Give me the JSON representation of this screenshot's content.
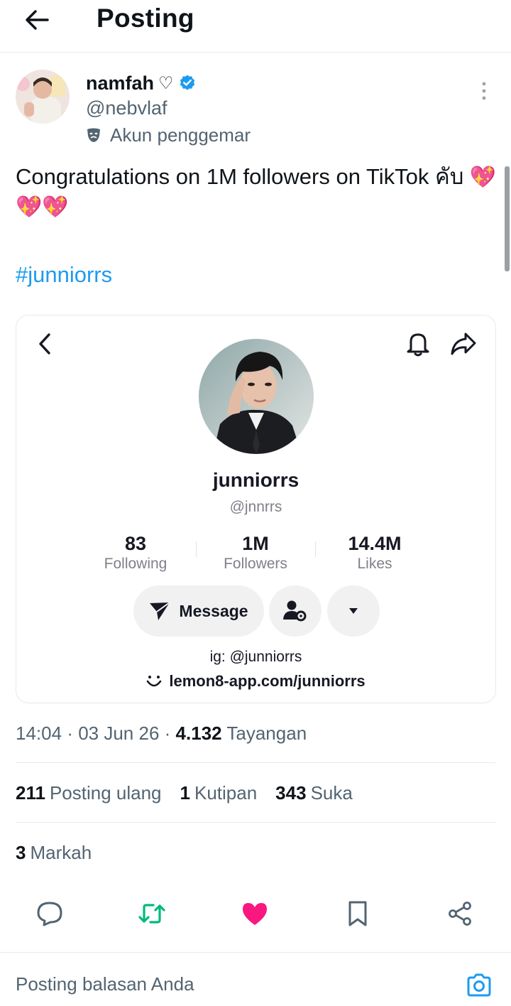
{
  "header": {
    "title": "Posting",
    "back_icon": "arrow-left-icon"
  },
  "author": {
    "name": "namfah",
    "name_suffix": "♡",
    "verified_color": "#1d9bf0",
    "handle": "@nebvlaf",
    "label": "Akun penggemar"
  },
  "tweet": {
    "text": "Congratulations on 1M followers on TikTok คับ",
    "emojis": "💖💖💖",
    "hashtag": "#junniorrs"
  },
  "card": {
    "profile_name": "junniorrs",
    "profile_handle": "@jnnrrs",
    "stats": [
      {
        "value": "83",
        "label": "Following"
      },
      {
        "value": "1M",
        "label": "Followers"
      },
      {
        "value": "14.4M",
        "label": "Likes"
      }
    ],
    "message_label": "Message",
    "bio_ig": "ig: @junniorrs",
    "bio_link": "lemon8-app.com/junniorrs"
  },
  "meta": {
    "time": "14:04",
    "date": "03 Jun 26",
    "views": "4.132",
    "views_label": "Tayangan"
  },
  "counts": {
    "reposts": "211",
    "reposts_label": "Posting ulang",
    "quotes": "1",
    "quotes_label": "Kutipan",
    "likes": "343",
    "likes_label": "Suka",
    "bookmarks": "3",
    "bookmarks_label": "Markah"
  },
  "colors": {
    "accent": "#1d9bf0",
    "repost": "#00ba7c",
    "like": "#f91880"
  },
  "reply": {
    "placeholder": "Posting balasan Anda"
  }
}
